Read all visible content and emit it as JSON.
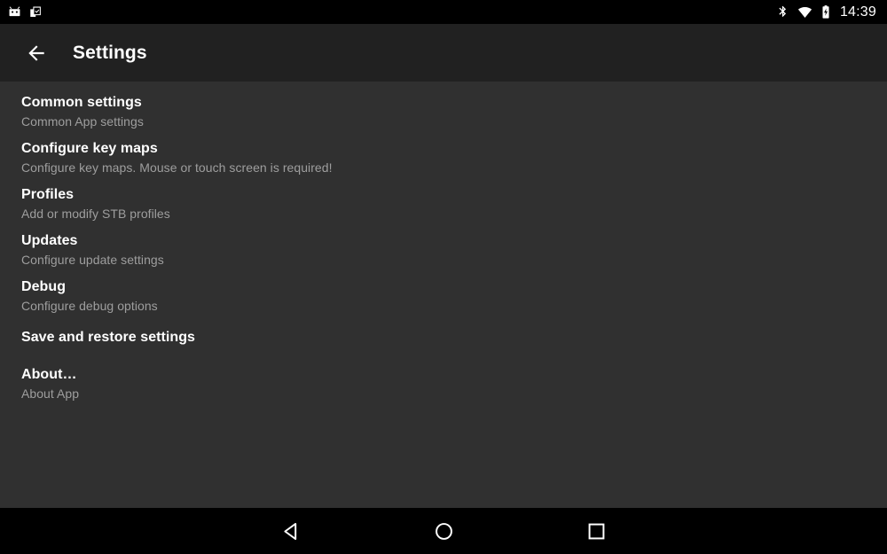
{
  "status_bar": {
    "background": "#000000",
    "notification_icons": [
      {
        "name": "app-notification-icon",
        "label": "App notification"
      },
      {
        "name": "clipboard-check-icon",
        "label": "Clipboard task"
      }
    ],
    "system_icons": [
      {
        "name": "bluetooth-icon",
        "label": "Bluetooth"
      },
      {
        "name": "wifi-icon",
        "label": "Wi-Fi"
      },
      {
        "name": "battery-charging-icon",
        "label": "Battery charging"
      }
    ],
    "clock": "14:39"
  },
  "app_bar": {
    "background": "#212121",
    "back_label": "Navigate up",
    "title": "Settings"
  },
  "content": {
    "background": "#303030",
    "title_color": "#ffffff",
    "summary_color": "#9e9e9e",
    "items": [
      {
        "title": "Common settings",
        "summary": "Common App settings",
        "key": "common-settings"
      },
      {
        "title": "Configure key maps",
        "summary": "Configure key maps. Mouse or touch screen is required!",
        "key": "configure-key-maps"
      },
      {
        "title": "Profiles",
        "summary": "Add or modify STB profiles",
        "key": "profiles"
      },
      {
        "title": "Updates",
        "summary": "Configure update settings",
        "key": "updates"
      },
      {
        "title": "Debug",
        "summary": "Configure debug options",
        "key": "debug"
      },
      {
        "title": "Save and restore settings",
        "summary": "",
        "key": "save-and-restore-settings"
      },
      {
        "title": "About…",
        "summary": "About App",
        "key": "about"
      }
    ]
  },
  "nav_bar": {
    "background": "#000000",
    "buttons": [
      {
        "name": "nav-back-button",
        "label": "Back",
        "icon": "triangle-left-icon"
      },
      {
        "name": "nav-home-button",
        "label": "Home",
        "icon": "circle-icon"
      },
      {
        "name": "nav-recents-button",
        "label": "Recents",
        "icon": "square-icon"
      }
    ]
  }
}
